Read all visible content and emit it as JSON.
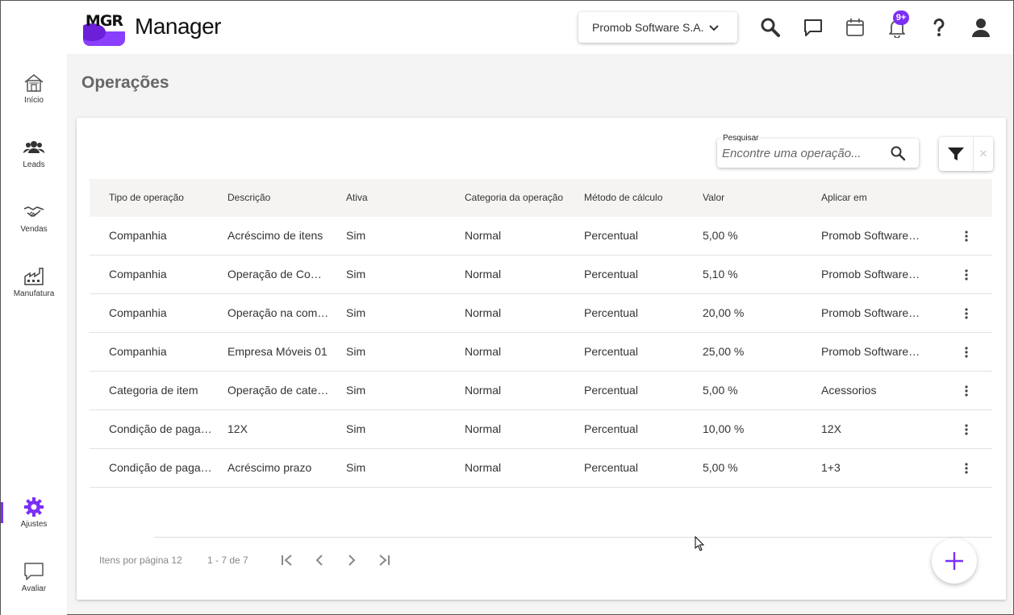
{
  "app": {
    "logo_text": "MGR",
    "name": "Manager",
    "company": "Promob Software S.A.",
    "notification_badge": "9+"
  },
  "sidebar": {
    "items": [
      {
        "label": "Início",
        "icon": "home-icon"
      },
      {
        "label": "Leads",
        "icon": "people-icon"
      },
      {
        "label": "Vendas",
        "icon": "handshake-icon"
      },
      {
        "label": "Manufatura",
        "icon": "factory-icon"
      },
      {
        "label": "Ajustes",
        "icon": "gear-icon"
      },
      {
        "label": "Avaliar",
        "icon": "chat-bubble-icon"
      }
    ]
  },
  "page": {
    "title": "Operações",
    "search_label": "Pesquisar",
    "search_placeholder": "Encontre uma operação..."
  },
  "table": {
    "headers": [
      "Tipo de operação",
      "Descrição",
      "Ativa",
      "Categoria da operação",
      "Método de cálculo",
      "Valor",
      "Aplicar em"
    ],
    "rows": [
      [
        "Companhia",
        "Acréscimo de itens",
        "Sim",
        "Normal",
        "Percentual",
        "5,00 %",
        "Promob Software S.A."
      ],
      [
        "Companhia",
        "Operação de Compra",
        "Sim",
        "Normal",
        "Percentual",
        "5,10 %",
        "Promob Software S.A."
      ],
      [
        "Companhia",
        "Operação na companhia",
        "Sim",
        "Normal",
        "Percentual",
        "20,00 %",
        "Promob Software S.A."
      ],
      [
        "Companhia",
        "Empresa Móveis 01",
        "Sim",
        "Normal",
        "Percentual",
        "25,00 %",
        "Promob Software S.A."
      ],
      [
        "Categoria de item",
        "Operação de categoria",
        "Sim",
        "Normal",
        "Percentual",
        "5,00 %",
        "Acessorios"
      ],
      [
        "Condição de pagamento",
        "12X",
        "Sim",
        "Normal",
        "Percentual",
        "10,00 %",
        "12X"
      ],
      [
        "Condição de pagamento",
        "Acréscimo prazo",
        "Sim",
        "Normal",
        "Percentual",
        "5,00 %",
        "1+3"
      ]
    ]
  },
  "pager": {
    "items_per_page": "Itens por página 12",
    "range": "1 - 7 de 7"
  },
  "colors": {
    "accent": "#7b2ff7"
  }
}
